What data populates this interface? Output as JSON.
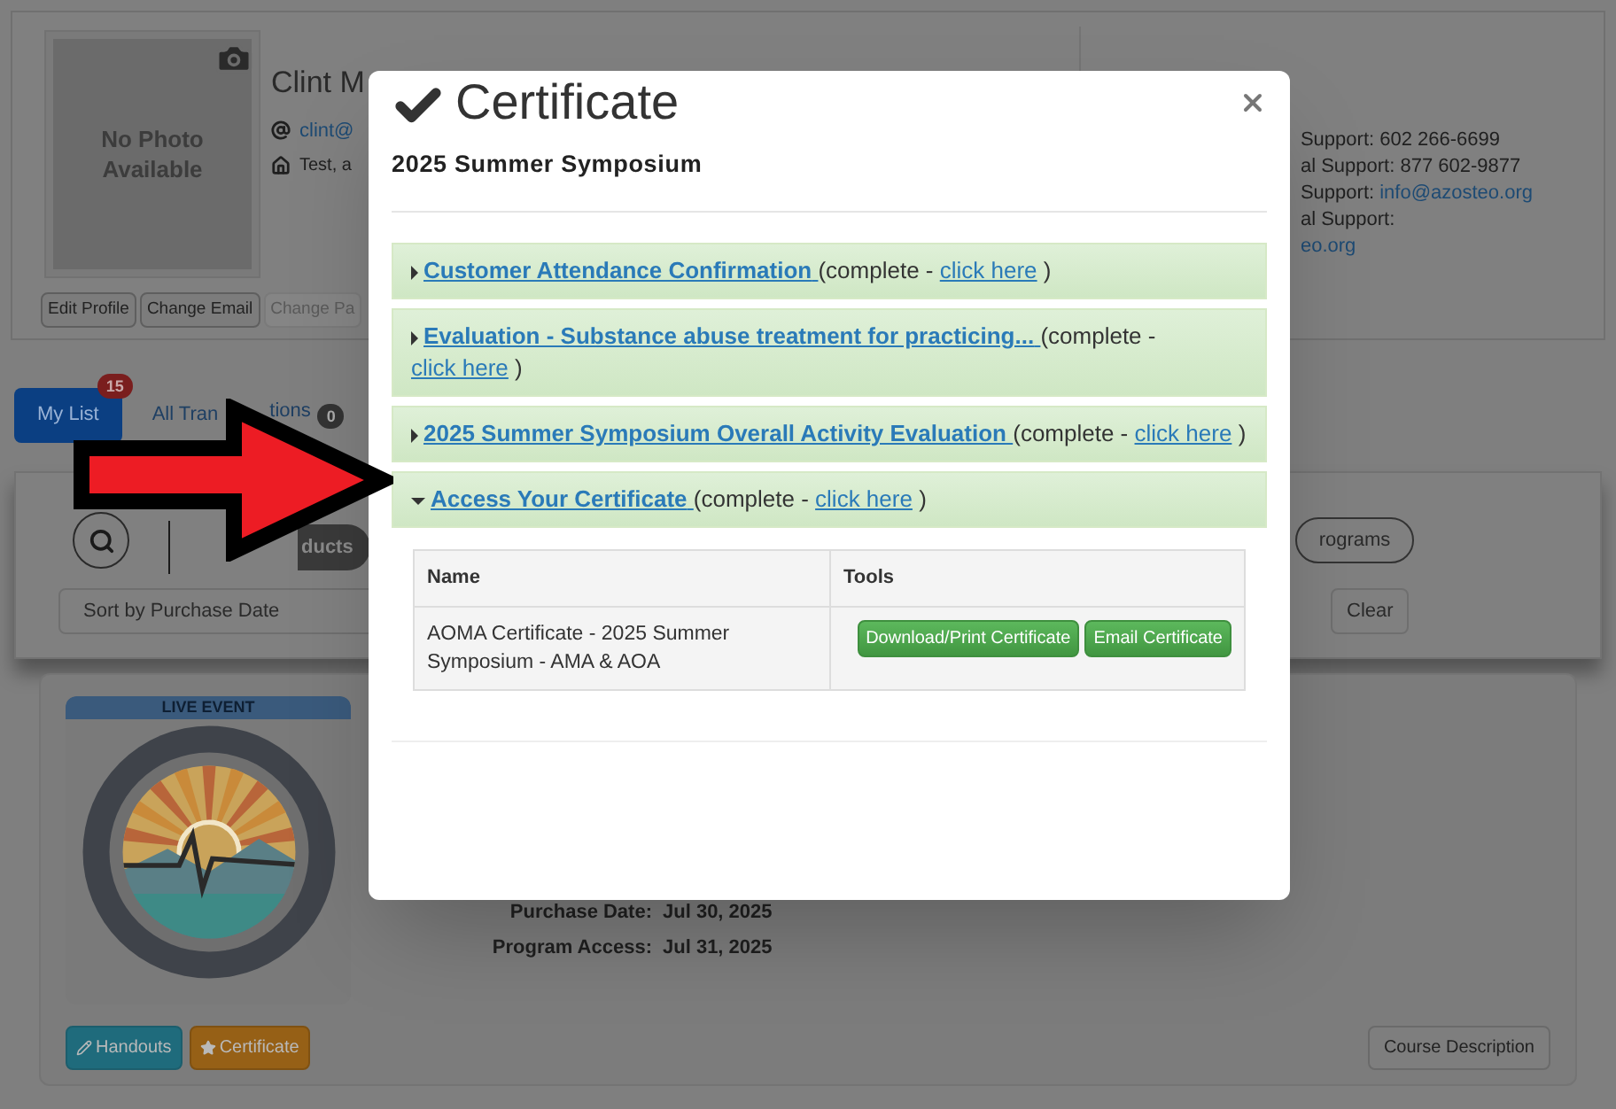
{
  "profile": {
    "photo_text": "No Photo Available",
    "name": "Clint M",
    "email": "clint@",
    "address": "Test, a",
    "buttons": [
      {
        "label": "Edit Profile",
        "disabled": false
      },
      {
        "label": "Change Email",
        "disabled": false
      },
      {
        "label": "Change Pa",
        "disabled": true
      }
    ]
  },
  "contact": {
    "lines": [
      {
        "label": "Support: 602 266-6699"
      },
      {
        "label": "al Support: 877 602-9877"
      },
      {
        "label": "Support: ",
        "link": "info@azosteo.org"
      },
      {
        "label": "al Support:"
      },
      {
        "link": "eo.org"
      }
    ]
  },
  "tabs": [
    {
      "label": "My List",
      "selected": true,
      "badge": "15"
    },
    {
      "label": "All Tran",
      "label_end": "tions",
      "selected": false,
      "badge": "0"
    }
  ],
  "filters": {
    "pills": [
      {
        "label": "ducts",
        "selected": true
      },
      {
        "label": "rograms",
        "selected": false
      }
    ],
    "sort": "Sort by Purchase Date",
    "clear": "Clear"
  },
  "product": {
    "tag": "LIVE EVENT",
    "details": [
      {
        "label": "Purchase Date:",
        "value": "Jul 30, 2025"
      },
      {
        "label": "Program Access:",
        "value": "Jul 31, 2025"
      }
    ],
    "buttons": [
      {
        "label": "Handouts",
        "kind": "info"
      },
      {
        "label": "Certificate",
        "kind": "warning"
      }
    ],
    "description_button": "Course Description"
  },
  "modal": {
    "title": "Certificate",
    "subtitle": "2025 Summer Symposium",
    "sections": [
      {
        "title": "Customer Attendance Confirmation",
        "status": "(complete -",
        "link": "click here",
        "end": ")",
        "expanded": false
      },
      {
        "title": "Evaluation - Substance abuse treatment for practicing...",
        "status": "(complete -",
        "link": "click here",
        "end": ")",
        "expanded": false
      },
      {
        "title": "2025 Summer Symposium Overall Activity Evaluation",
        "status": "(complete -",
        "link": "click here",
        "end": ")",
        "expanded": false
      },
      {
        "title": "Access Your Certificate",
        "status": "(complete -",
        "link": "click here",
        "end": ")",
        "expanded": true
      }
    ],
    "table": {
      "columns": [
        "Name",
        "Tools"
      ],
      "rows": [
        {
          "name": "AOMA Certificate - 2025 Summer Symposium - AMA & AOA",
          "actions": [
            "Download/Print Certificate",
            "Email Certificate"
          ]
        }
      ]
    }
  }
}
